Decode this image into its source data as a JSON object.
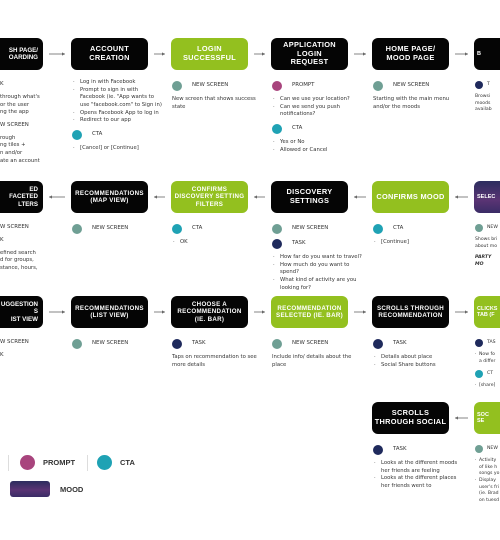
{
  "colors": {
    "new_screen": "#6f9f94",
    "task": "#1f2a5c",
    "prompt": "#a8447d",
    "cta": "#1fa2b4",
    "box_black": "#050505",
    "box_green": "#93c01f",
    "mood_gradient": [
      "#2c2d5e",
      "#5a3474"
    ]
  },
  "nodes": [
    {
      "id": "splash",
      "style": "black",
      "label": "SH PAGE/\nOARDING",
      "details": [
        {
          "type": "dot",
          "kind": "task",
          "label": "K",
          "dot_hidden": true
        },
        {
          "type": "text",
          "text": "through what's\nor the user\nng the app"
        },
        {
          "type": "dot",
          "kind": "new_screen",
          "label": "W SCREEN",
          "dot_hidden": true
        },
        {
          "type": "text",
          "text": "rough\nng tiles +\nn  and/or\nate an account"
        }
      ]
    },
    {
      "id": "account-creation",
      "style": "black",
      "label": "ACCOUNT\nCREATION",
      "details": [
        {
          "type": "bullets",
          "items": [
            "Log in with Facebook",
            "Prompt to sign in with Facebook (ie. \"App wants to use \"facebook.com\" to Sign in)",
            "Opens Facebook App to log in",
            "Redirect to our app"
          ]
        },
        {
          "type": "dot",
          "kind": "cta",
          "label": "CTA"
        },
        {
          "type": "bullets",
          "items": [
            "[Cancel] or [Continue]"
          ]
        }
      ]
    },
    {
      "id": "login-successful",
      "style": "green",
      "label": "LOGIN\nSUCCESSFUL",
      "details": [
        {
          "type": "dot",
          "kind": "new_screen",
          "label": "NEW SCREEN"
        },
        {
          "type": "text",
          "text": "New screen that shows success state"
        }
      ]
    },
    {
      "id": "application-login-request",
      "style": "black",
      "label": "APPLICATION\nLOGIN\nREQUEST",
      "details": [
        {
          "type": "dot",
          "kind": "prompt",
          "label": "PROMPT"
        },
        {
          "type": "bullets",
          "items": [
            "Can we use your location?",
            "Can we send you push notifications?"
          ]
        },
        {
          "type": "dot",
          "kind": "cta",
          "label": "CTA"
        },
        {
          "type": "bullets",
          "items": [
            "Yes or No",
            "Allowed or Cancel"
          ]
        }
      ]
    },
    {
      "id": "home-mood-page",
      "style": "black",
      "label": "HOME PAGE/\nMOOD PAGE",
      "details": [
        {
          "type": "dot",
          "kind": "new_screen",
          "label": "NEW SCREEN"
        },
        {
          "type": "text",
          "text": "Starting with the main menu and/or the moods"
        }
      ]
    },
    {
      "id": "browse-moods",
      "style": "black",
      "label": "B",
      "details": [
        {
          "type": "dot",
          "kind": "task",
          "label": "T"
        },
        {
          "type": "text",
          "text": "Browsi\nmoods\navailab"
        }
      ]
    },
    {
      "id": "faceted-filters",
      "style": "black",
      "label": "ED FACETED\nLTERS",
      "details": [
        {
          "type": "dot",
          "kind": "new_screen",
          "label": "W SCREEN",
          "dot_hidden": true
        },
        {
          "type": "dot",
          "kind": "task",
          "label": "K",
          "dot_hidden": true
        },
        {
          "type": "text",
          "text": "efined search\nd for groups,\nstance, hours,"
        }
      ]
    },
    {
      "id": "recommendations-map",
      "style": "black",
      "label": "RECOMMENDATIONS\n(MAP VIEW)",
      "small": true,
      "details": [
        {
          "type": "dot",
          "kind": "new_screen",
          "label": "NEW SCREEN"
        }
      ]
    },
    {
      "id": "confirms-discovery-filters",
      "style": "green",
      "label": "CONFIRMS\nDISCOVERY SETTING\nFILTERS",
      "small": true,
      "details": [
        {
          "type": "dot",
          "kind": "cta",
          "label": "CTA"
        },
        {
          "type": "bullets",
          "items": [
            "OK"
          ]
        }
      ]
    },
    {
      "id": "discovery-settings",
      "style": "black",
      "label": "DISCOVERY\nSETTINGS",
      "details": [
        {
          "type": "dot",
          "kind": "new_screen",
          "label": "NEW SCREEN"
        },
        {
          "type": "dot",
          "kind": "task",
          "label": "TASK"
        },
        {
          "type": "bullets",
          "items": [
            "How far do you want to travel?",
            "How much do you want to spend?",
            "What kind of activity are you looking for?"
          ]
        }
      ]
    },
    {
      "id": "confirms-mood",
      "style": "green",
      "label": "CONFIRMS MOOD",
      "details": [
        {
          "type": "dot",
          "kind": "cta",
          "label": "CTA"
        },
        {
          "type": "bullets",
          "items": [
            "[Continue]"
          ]
        }
      ]
    },
    {
      "id": "select-mood",
      "style": "mood",
      "label": "SELEC",
      "details": [
        {
          "type": "dot",
          "kind": "new_screen",
          "label": "NEW"
        },
        {
          "type": "text",
          "text": "Shows bri\nabout mo"
        },
        {
          "type": "italic",
          "text": "PARTY MO"
        }
      ]
    },
    {
      "id": "suggestions-list",
      "style": "black",
      "label": "UGGESTIONS\nIST VIEW",
      "details": [
        {
          "type": "dot",
          "kind": "new_screen",
          "label": "W SCREEN",
          "dot_hidden": true
        },
        {
          "type": "dot",
          "kind": "task",
          "label": "K",
          "dot_hidden": true
        }
      ]
    },
    {
      "id": "recommendations-list",
      "style": "black",
      "label": "RECOMMENDATIONS\n(LIST VIEW)",
      "small": true,
      "details": [
        {
          "type": "dot",
          "kind": "new_screen",
          "label": "NEW SCREEN"
        }
      ]
    },
    {
      "id": "choose-recommendation",
      "style": "black",
      "label": "CHOOSE A\nRECOMMENDATION\n(IE. BAR)",
      "small": true,
      "details": [
        {
          "type": "dot",
          "kind": "task",
          "label": "TASK"
        },
        {
          "type": "text",
          "text": "Taps on recommendation to see more details"
        }
      ]
    },
    {
      "id": "recommendation-selected",
      "style": "green",
      "label": "RECOMMENDATION\nSELECTED (IE. BAR)",
      "small": true,
      "details": [
        {
          "type": "dot",
          "kind": "new_screen",
          "label": "NEW SCREEN"
        },
        {
          "type": "text",
          "text": "Include info/ details about the place"
        }
      ]
    },
    {
      "id": "scrolls-recommendation",
      "style": "black",
      "label": "SCROLLS THROUGH\nRECOMMENDATION",
      "small": true,
      "details": [
        {
          "type": "dot",
          "kind": "task",
          "label": "TASK"
        },
        {
          "type": "bullets",
          "items": [
            "Details about place",
            "Social Share buttons"
          ]
        }
      ]
    },
    {
      "id": "clicks-tab",
      "style": "green",
      "label": "CLICKS\nTAB (F",
      "small": true,
      "details": [
        {
          "type": "dot",
          "kind": "task",
          "label": "TAS"
        },
        {
          "type": "bullets",
          "items": [
            "Now fo\na differ"
          ]
        },
        {
          "type": "dot",
          "kind": "cta",
          "label": "CT"
        },
        {
          "type": "bullets",
          "items": [
            "[share]"
          ]
        }
      ]
    },
    {
      "id": "scrolls-social",
      "style": "black",
      "label": "SCROLLS\nTHROUGH SOCIAL",
      "details": [
        {
          "type": "dot",
          "kind": "task",
          "label": "TASK"
        },
        {
          "type": "bullets",
          "items": [
            "Looks at the different moods her friends are feeling",
            "Looks at the different places her friends went to"
          ]
        }
      ]
    },
    {
      "id": "social-section",
      "style": "green",
      "label": "SOC\nSE",
      "details": [
        {
          "type": "dot",
          "kind": "new_screen",
          "label": "NEW"
        },
        {
          "type": "bullets",
          "items": [
            "Activity\nof like h\nsongs yo",
            "Display\nuser's fri\n(ie. Brad\non tuesd"
          ]
        }
      ]
    }
  ],
  "legend": [
    {
      "kind": "prompt",
      "label": "PROMPT"
    },
    {
      "kind": "cta",
      "label": "CTA"
    },
    {
      "kind": "mood",
      "label": "MOOD"
    }
  ]
}
